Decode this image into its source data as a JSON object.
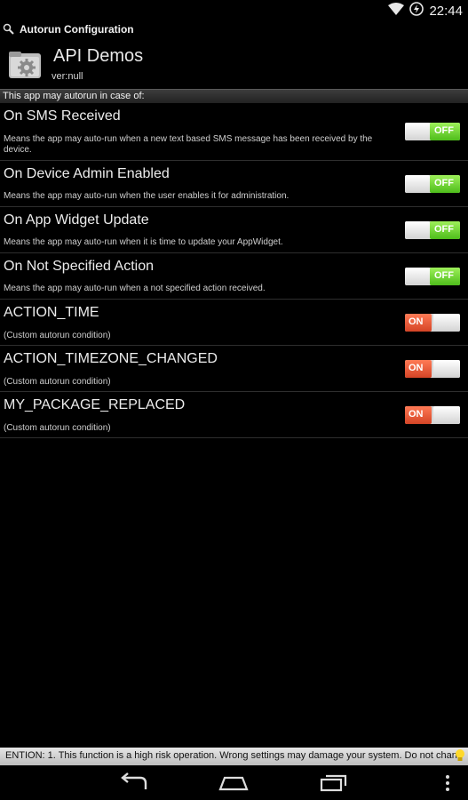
{
  "status_bar": {
    "time": "22:44",
    "icons": [
      "wifi-icon",
      "power-saver-icon"
    ]
  },
  "app_bar": {
    "title": "Autorun Configuration",
    "app_name": "API Demos",
    "version": "ver:null",
    "icons": [
      "search-settings-icon",
      "app-settings-icon"
    ]
  },
  "section_header": "This app may autorun in case of:",
  "items": [
    {
      "title": "On SMS Received",
      "description": "Means the app may auto-run when a new text based SMS message has been received by the device.",
      "toggle": "OFF"
    },
    {
      "title": "On Device Admin Enabled",
      "description": "Means the app may auto-run when the user enables it for administration.",
      "toggle": "OFF"
    },
    {
      "title": "On App Widget Update",
      "description": "Means the app may auto-run when it is time to update your AppWidget.",
      "toggle": "OFF"
    },
    {
      "title": "On Not Specified Action",
      "description": "Means the app may auto-run when a not specified action received.",
      "toggle": "OFF"
    },
    {
      "title": "ACTION_TIME",
      "description": "(Custom autorun condition)",
      "toggle": "ON"
    },
    {
      "title": "ACTION_TIMEZONE_CHANGED",
      "description": "(Custom autorun condition)",
      "toggle": "ON"
    },
    {
      "title": "MY_PACKAGE_REPLACED",
      "description": "(Custom autorun condition)",
      "toggle": "ON"
    }
  ],
  "warning": "ENTION: 1. This function is a high risk operation. Wrong settings may damage your system. Do not chang",
  "nav_bar": [
    "back-icon",
    "home-icon",
    "recents-icon",
    "overflow-menu-icon"
  ],
  "colors": {
    "on": "#e0532f",
    "off": "#6fd63a",
    "background": "#000000"
  }
}
